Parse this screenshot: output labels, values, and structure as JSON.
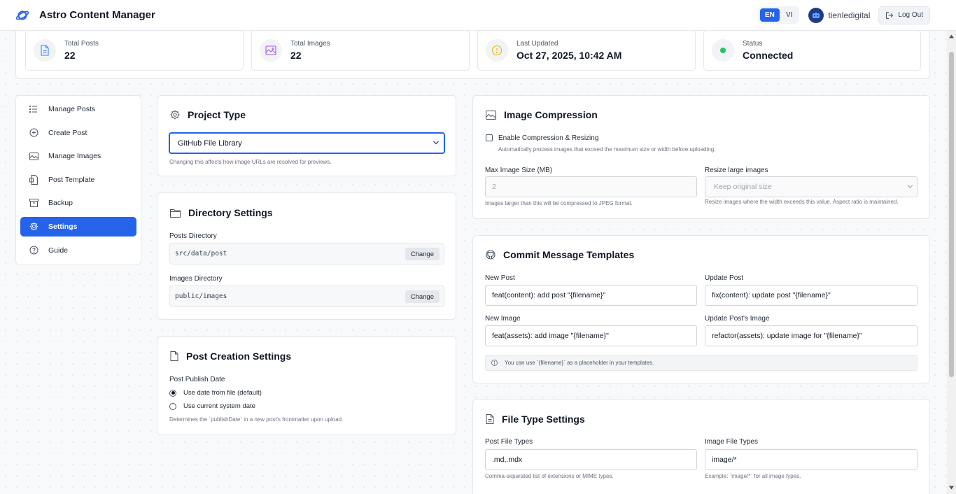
{
  "header": {
    "title": "Astro Content Manager",
    "languages": [
      "EN",
      "VI"
    ],
    "username": "tienledigital",
    "logout_label": "Log Out"
  },
  "stats": [
    {
      "label": "Total Posts",
      "value": "22",
      "icon": "file-icon"
    },
    {
      "label": "Total Images",
      "value": "22",
      "icon": "image-icon"
    },
    {
      "label": "Last Updated",
      "value": "Oct 27, 2025, 10:42 AM",
      "icon": "clock-icon"
    },
    {
      "label": "Status",
      "value": "Connected",
      "icon": "status-dot-icon"
    }
  ],
  "sidebar": {
    "items": [
      {
        "label": "Manage Posts",
        "icon": "list-icon",
        "active": false
      },
      {
        "label": "Create Post",
        "icon": "plus-circle-icon",
        "active": false
      },
      {
        "label": "Manage Images",
        "icon": "image-icon",
        "active": false
      },
      {
        "label": "Post Template",
        "icon": "template-icon",
        "active": false
      },
      {
        "label": "Backup",
        "icon": "archive-icon",
        "active": false
      },
      {
        "label": "Settings",
        "icon": "gear-icon",
        "active": true
      },
      {
        "label": "Guide",
        "icon": "help-circle-icon",
        "active": false
      }
    ]
  },
  "project_type": {
    "title": "Project Type",
    "selected": "GitHub File Library",
    "hint": "Changing this affects how image URLs are resolved for previews."
  },
  "directory": {
    "title": "Directory Settings",
    "posts_label": "Posts Directory",
    "posts_value": "src/data/post",
    "images_label": "Images Directory",
    "images_value": "public/images",
    "change_label": "Change"
  },
  "post_creation": {
    "title": "Post Creation Settings",
    "date_label": "Post Publish Date",
    "option_file": "Use date from file (default)",
    "option_system": "Use current system date",
    "selected": "file",
    "hint": "Determines the `publishDate` in a new post's frontmatter upon upload."
  },
  "compression": {
    "title": "Image Compression",
    "enable_label": "Enable Compression & Resizing",
    "enable_checked": false,
    "enable_hint": "Automatically process images that exceed the maximum size or width before uploading.",
    "max_size_label": "Max Image Size (MB)",
    "max_size_value": "2",
    "max_size_hint": "Images larger than this will be compressed to JPEG format.",
    "resize_label": "Resize large images",
    "resize_value": "Keep original size",
    "resize_hint": "Resize images where the width exceeds this value. Aspect ratio is maintained."
  },
  "commit": {
    "title": "Commit Message Templates",
    "new_post_label": "New Post",
    "new_post_value": "feat(content): add post \"{filename}\"",
    "update_post_label": "Update Post",
    "update_post_value": "fix(content): update post \"{filename}\"",
    "new_image_label": "New Image",
    "new_image_value": "feat(assets): add image \"{filename}\"",
    "update_image_label": "Update Post's Image",
    "update_image_value": "refactor(assets): update image for \"{filename}\"",
    "note": "You can use `{filename}` as a placeholder in your templates."
  },
  "file_types": {
    "title": "File Type Settings",
    "post_label": "Post File Types",
    "post_value": ".md,.mdx",
    "post_hint": "Comma-separated list of extensions or MIME types.",
    "image_label": "Image File Types",
    "image_value": "image/*",
    "image_hint": "Example: `image/*` for all image types."
  },
  "colors": {
    "accent": "#2563eb",
    "status_connected": "#22c55e",
    "image_icon": "#a855f7",
    "clock_icon": "#eab308"
  }
}
